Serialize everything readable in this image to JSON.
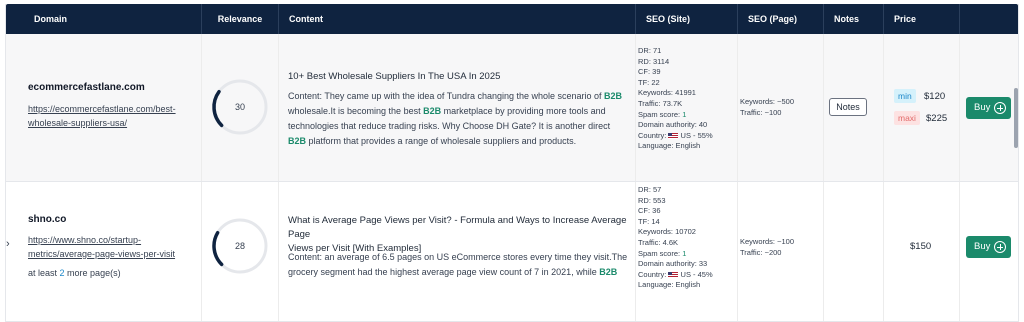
{
  "header": {
    "col_domain": "Domain",
    "col_relevance": "Relevance",
    "col_content": "Content",
    "col_seo_site": "SEO (Site)",
    "col_seo_page": "SEO (Page)",
    "col_notes": "Notes",
    "col_price": "Price"
  },
  "rows": [
    {
      "domain": "ecommercefastlane.com",
      "link_line1": "https://ecommercefastlane.com/best-",
      "link_line2": "wholesale-suppliers-usa/",
      "relevance": "30",
      "relevance_value": 30,
      "title": "10+ Best Wholesale Suppliers In The USA In 2025",
      "content": {
        "l1a": "Content: They came up with the idea of Tundra changing the whole scenario of ",
        "l1b": "B2B",
        "l2a": "wholesale.It is becoming the best ",
        "l2b": "B2B",
        "l2c": " marketplace by providing more tools and",
        "l3": "technologies that reduce trading risks.  Why Choose DH Gate? It is another direct",
        "l4a": "B2B",
        "l4b": " platform that provides a range of wholesale suppliers and products."
      },
      "seo_site": {
        "dr": "DR: 71",
        "rd": "RD: 3114",
        "cf": "CF: 39",
        "tf": "TF: 22",
        "keywords": "Keywords: 41991",
        "traffic": "Traffic: 73.7K",
        "spam_label": "Spam score: ",
        "spam_value": "1",
        "authority": "Domain authority: 40",
        "country": "Country:",
        "country_value": "US - 55%",
        "language": "Language: English"
      },
      "seo_page": {
        "keywords": "Keywords: ~500",
        "traffic": "Traffic: ~100"
      },
      "notes_label": "Notes",
      "price_min_label": "min",
      "price_min": "$120",
      "price_max_label": "maxi",
      "price_max": "$225",
      "buy_label": "Buy"
    },
    {
      "domain": "shno.co",
      "link_line1": "https://www.shno.co/startup-",
      "link_line2": "metrics/average-page-views-per-visit",
      "more_prefix": "at least ",
      "more_count": "2",
      "more_suffix": " more page(s)",
      "relevance": "28",
      "relevance_value": 28,
      "title_line1": "What is Average Page Views per Visit? - Formula and Ways to Increase Average Page",
      "title_line2": "Views per Visit [With Examples]",
      "content": {
        "l1": "Content: an average of 6.5 pages on US eCommerce stores every time they visit.The",
        "l2a": "grocery segment had the highest average page view count of 7 in 2021, while ",
        "l2b": "B2B"
      },
      "seo_site": {
        "dr": "DR: 57",
        "rd": "RD: 553",
        "cf": "CF: 36",
        "tf": "TF: 14",
        "keywords": "Keywords: 10702",
        "traffic": "Traffic: 4.6K",
        "spam_label": "Spam score: ",
        "spam_value": "1",
        "authority": "Domain authority: 33",
        "country": "Country:",
        "country_value": "US - 45%",
        "language": "Language: English"
      },
      "seo_page": {
        "keywords": "Keywords: ~100",
        "traffic": "Traffic: ~200"
      },
      "price": "$150",
      "buy_label": "Buy",
      "expand_icon": "chevron-right-icon"
    }
  ],
  "colors": {
    "header_bg": "#0f2340",
    "accent_green": "#1b8a6b",
    "gauge_arc": "#0f2340"
  }
}
